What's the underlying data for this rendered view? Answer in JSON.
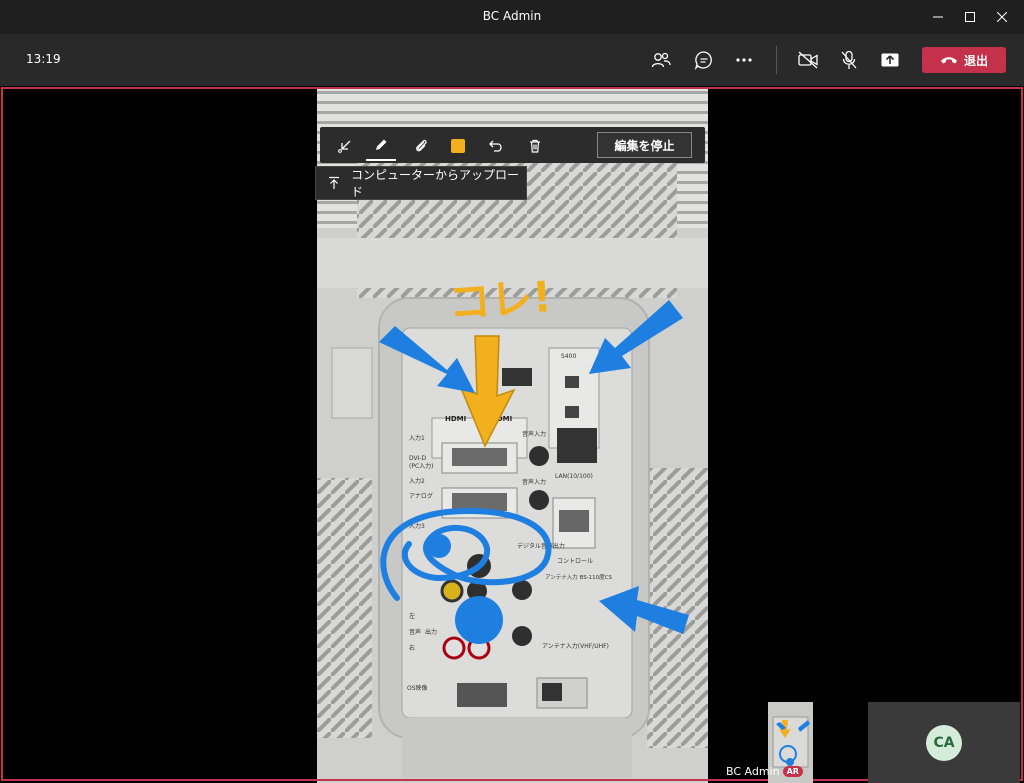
{
  "window": {
    "title": "BC Admin"
  },
  "toolbar": {
    "time": "13:19",
    "leave_label": "退出"
  },
  "annotation": {
    "stop_editing_label": "編集を停止",
    "upload_label": "コンピューターからアップロード",
    "color": "#f2b01e"
  },
  "annotation_text": "コレ!",
  "participants": {
    "self_name": "BC Admin",
    "self_badge": "AR",
    "remote_initials": "CA"
  },
  "video_labels": {
    "l1": "入力1",
    "l2": "DVI-D",
    "l3": "(PC入力)",
    "l4": "入力2",
    "l5": "アナログ",
    "l6": "入力3",
    "l7": "音声入力",
    "l8": "音声入力",
    "l9": "LAN(10/100)",
    "l10": "コントロール",
    "l11": "デジタル音声出力",
    "l12": "アンテナ入力 BS-110度CS",
    "l13": "アンテナ入力(VHF/UHF)",
    "l14": "OS映像",
    "l15": "S400",
    "l16": "HDMI",
    "l17": "HDMI",
    "l18": "左",
    "l19": "右",
    "l20": "音声",
    "l21": "出力"
  },
  "colors": {
    "accent_red": "#c4314b",
    "arrow_blue": "#1e7fe0",
    "arrow_yellow": "#f2b01e"
  }
}
